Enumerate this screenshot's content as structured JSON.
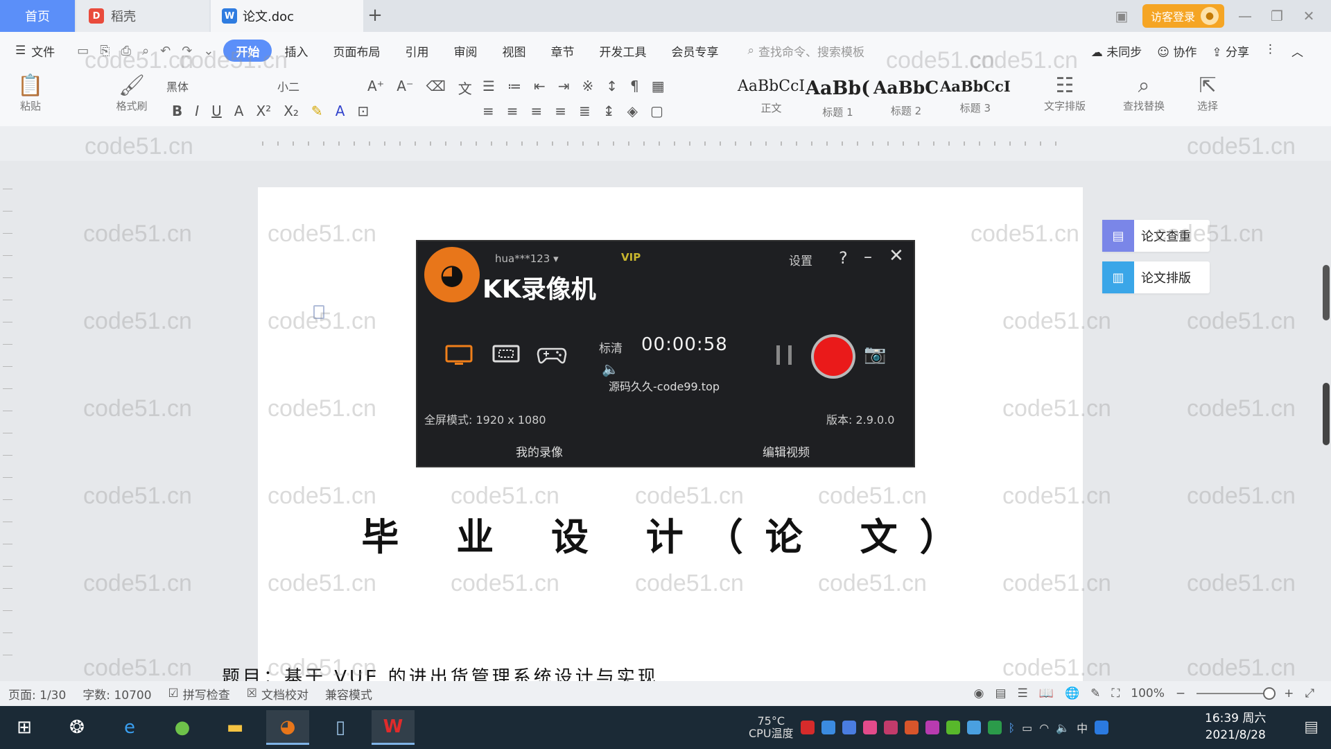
{
  "tabs": {
    "home": "首页",
    "daoke": "稻壳",
    "doc": "论文.doc",
    "new": "+"
  },
  "window": {
    "login": "访客登录"
  },
  "menu": {
    "file": "文件",
    "items": [
      "开始",
      "插入",
      "页面布局",
      "引用",
      "审阅",
      "视图",
      "章节",
      "开发工具",
      "会员专享"
    ],
    "search_cmd": "查找命令、搜索模板",
    "unsynced": "未同步",
    "collaborate": "协作",
    "share": "分享"
  },
  "toolbar": {
    "paste": "粘贴",
    "format_painter": "格式刷",
    "font": "黑体",
    "font_size": "小二",
    "styles": [
      {
        "sample": "AaBbCcI",
        "caption": "正文"
      },
      {
        "sample": "AaBb(",
        "caption": "标题 1"
      },
      {
        "sample": "AaBbC",
        "caption": "标题 2"
      },
      {
        "sample": "AaBbCcI",
        "caption": "标题 3"
      }
    ],
    "text_layout": "文字排版",
    "find_replace": "查找替换",
    "select": "选择"
  },
  "document": {
    "title": "毕 业 设 计（论 文）",
    "subtitle_partial": "题目：基于 VUE 的进出货管理系统设计与实现"
  },
  "side_panel": {
    "check": "论文查重",
    "layout": "论文排版"
  },
  "watermark": "code51.cn",
  "recorder": {
    "user": "hua***123",
    "vip": "VIP",
    "title": "KK录像机",
    "settings": "设置",
    "quality": "标清",
    "timer": "00:00:58",
    "overlay": "源码久久-code99.top",
    "fullscreen": "全屏模式: 1920 x 1080",
    "version": "版本: 2.9.0.0",
    "my_recordings": "我的录像",
    "edit_video": "编辑视频"
  },
  "statusbar": {
    "page": "页面: 1/30",
    "words": "字数: 10700",
    "spellcheck": "拼写检查",
    "proofread": "文档校对",
    "compat": "兼容模式",
    "zoom": "100%"
  },
  "taskbar": {
    "temp": "75°C",
    "cpu": "CPU温度",
    "ime": "中",
    "time": "16:39 周六",
    "date": "2021/8/28"
  },
  "colors": {
    "accent": "#5b8ff9",
    "record_red": "#ea1a1a",
    "login_orange": "#f5a524",
    "recorder_bg": "#1e1f22"
  }
}
